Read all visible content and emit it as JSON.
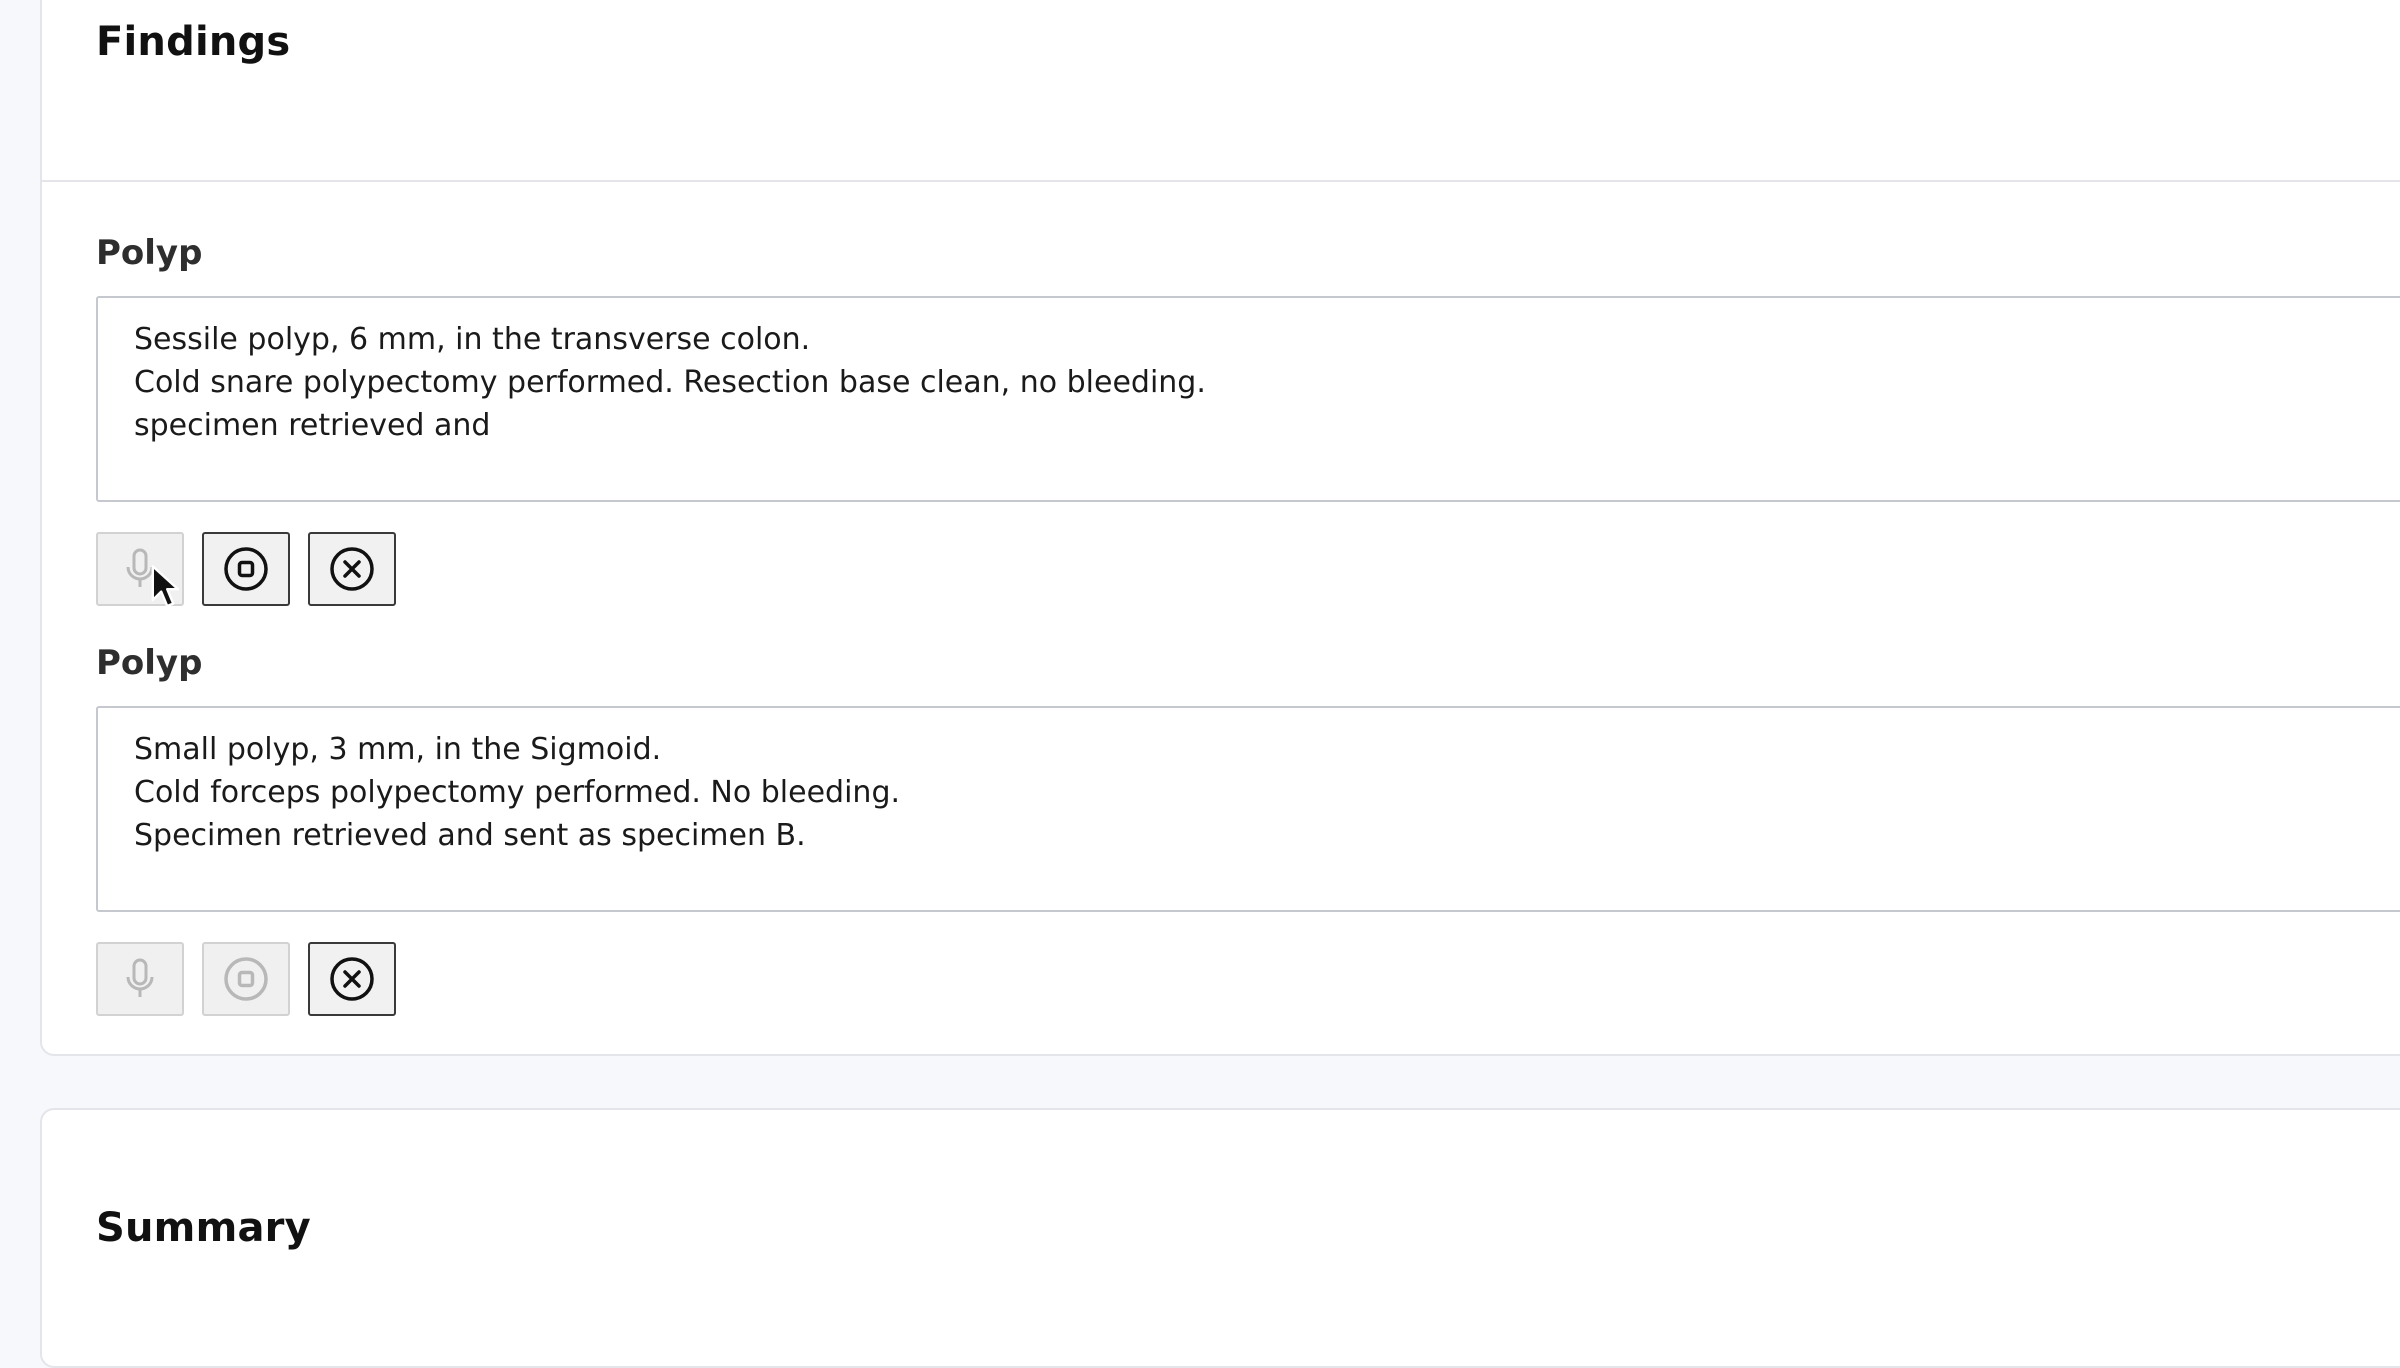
{
  "findings": {
    "title": "Findings",
    "items": [
      {
        "label": "Polyp",
        "text": "Sessile polyp, 6 mm, in the transverse colon.\nCold snare polypectomy performed. Resection base clean, no bleeding.\nspecimen retrieved and",
        "buttons": [
          {
            "icon": "microphone-icon",
            "enabled": false
          },
          {
            "icon": "stop-icon",
            "enabled": true
          },
          {
            "icon": "clear-icon",
            "enabled": true
          }
        ]
      },
      {
        "label": "Polyp",
        "text": "Small polyp, 3 mm, in the Sigmoid.\nCold forceps polypectomy performed. No bleeding.\nSpecimen retrieved and sent as specimen B.",
        "buttons": [
          {
            "icon": "microphone-icon",
            "enabled": false
          },
          {
            "icon": "stop-icon",
            "enabled": false
          },
          {
            "icon": "clear-icon",
            "enabled": true
          }
        ]
      }
    ]
  },
  "summary": {
    "title": "Summary"
  },
  "colors": {
    "background": "#f7f8fb",
    "card": "#ffffff",
    "border": "#e3e5ea",
    "text": "#111111",
    "button_border": "#3a3a3a",
    "disabled_icon": "#b8b8b8"
  }
}
